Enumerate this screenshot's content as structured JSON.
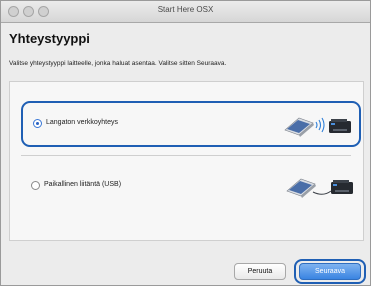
{
  "window": {
    "title": "Start Here OSX"
  },
  "page": {
    "heading": "Yhteystyyppi",
    "instruction": "Valitse yhteystyyppi laitteelle, jonka haluat asentaa. Valitse sitten Seuraava."
  },
  "options": [
    {
      "label": "Langaton verkkoyhteys",
      "selected": true,
      "illustration": "laptop-wifi-printer-illustration"
    },
    {
      "label": "Paikallinen liitäntä (USB)",
      "selected": false,
      "illustration": "laptop-usb-printer-illustration"
    }
  ],
  "buttons": {
    "cancel": "Peruuta",
    "next": "Seuraava"
  },
  "colors": {
    "highlight": "#1f5fb4",
    "primary_button": "#3a84e2"
  }
}
